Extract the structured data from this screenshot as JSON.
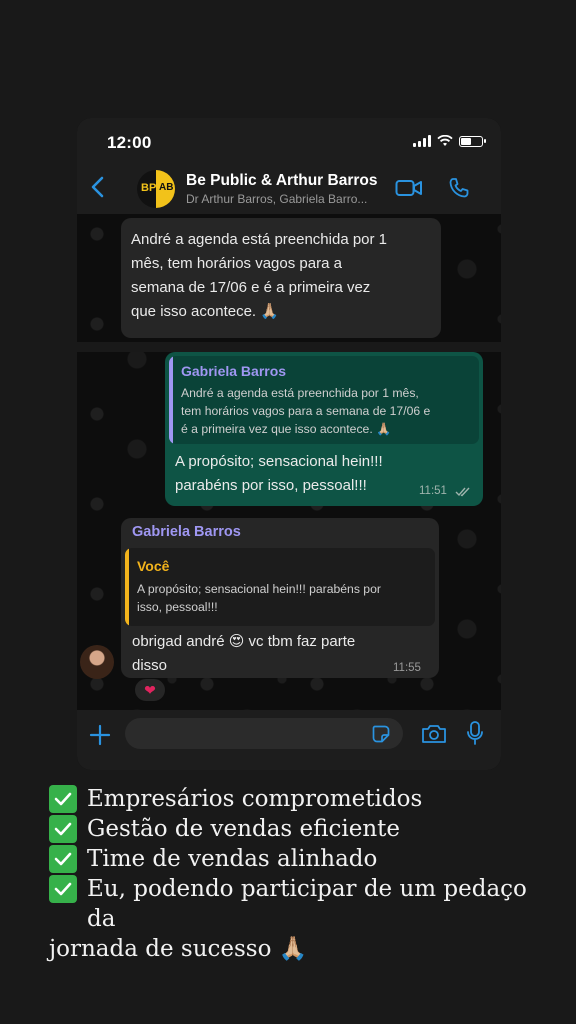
{
  "status_bar": {
    "time": "12:00"
  },
  "header": {
    "title": "Be Public & Arthur Barros",
    "subtitle": "Dr Arthur Barros, Gabriela Barro...",
    "avatar_text_left": "BP",
    "avatar_text_right": "AB"
  },
  "messages": {
    "m1": {
      "lines": [
        "André a agenda está preenchida por 1",
        "mês, tem horários vagos para a",
        "semana de 17/06 e é a primeira vez",
        "que isso acontece. 🙏🏼"
      ]
    },
    "m2": {
      "quote_author": "Gabriela Barros",
      "quote_lines": [
        "André a agenda está preenchida por 1 mês,",
        "tem horários vagos para a semana de 17/06 e",
        "é a primeira vez que isso acontece. 🙏🏼"
      ],
      "lines": [
        "A propósito; sensacional hein!!!",
        "parabéns por isso, pessoal!!!"
      ],
      "time": "11:51"
    },
    "m3": {
      "sender": "Gabriela Barros",
      "quote_author": "Você",
      "quote_lines": [
        "A propósito; sensacional hein!!! parabéns por",
        "isso, pessoal!!!"
      ],
      "lines": [
        "obrigad andré 😍 vc tbm faz parte",
        "disso"
      ],
      "time": "11:55",
      "reaction": "❤"
    }
  },
  "input": {
    "placeholder": ""
  },
  "caption": {
    "lines": [
      "Empresários comprometidos",
      "Gestão de vendas eficiente",
      "Time de vendas alinhado",
      "Eu, podendo participar de um pedaço da"
    ],
    "last_line": "jornada de sucesso 🙏🏼"
  },
  "colors": {
    "incoming_bubble": "#262626",
    "outgoing_bubble": "#0e5445",
    "quote_author_purple": "#9f97f2",
    "quote_author_yellow": "#f3b41c",
    "accent_blue": "#2a93e0",
    "check_green": "#36b14a"
  },
  "icons": [
    "back-chevron-icon",
    "video-call-icon",
    "phone-call-icon",
    "plus-icon",
    "sticker-icon",
    "camera-icon",
    "mic-icon",
    "check-mark-icon",
    "read-receipt-icon"
  ]
}
